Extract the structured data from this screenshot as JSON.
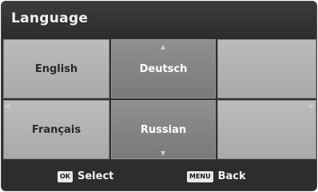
{
  "header": {
    "title": "Language"
  },
  "languages": [
    {
      "label": "English",
      "selected": false
    },
    {
      "label": "Deutsch",
      "selected": true
    },
    {
      "label": "",
      "selected": false
    },
    {
      "label": "Français",
      "selected": false
    },
    {
      "label": "Russian",
      "selected": true
    },
    {
      "label": "",
      "selected": false
    }
  ],
  "footer": {
    "ok_key": "OK",
    "ok_label": "Select",
    "menu_key": "MENU",
    "menu_label": "Back"
  },
  "colors": {
    "background": "#2a2a2a",
    "cell": "#b4b4b4",
    "cell_selected": "#858585",
    "text_light": "#ffffff",
    "text_dark": "#2a2a2a"
  },
  "icons": {
    "up": "arrow-up-icon",
    "down": "arrow-down-icon",
    "left": "arrow-left-icon",
    "right": "arrow-right-icon"
  }
}
